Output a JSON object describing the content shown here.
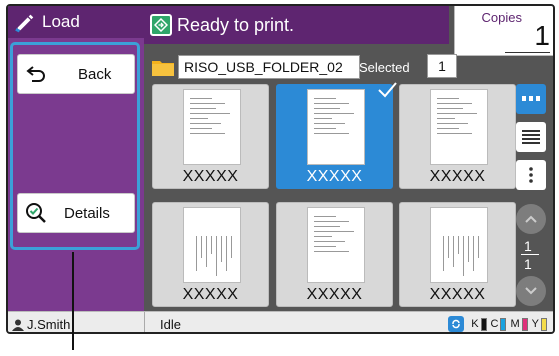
{
  "left_panel": {
    "title": "Load",
    "back_label": "Back",
    "details_label": "Details"
  },
  "status": {
    "message": "Ready to print."
  },
  "copies": {
    "label": "Copies",
    "value": "1"
  },
  "folder": {
    "name": "RISO_USB_FOLDER_02",
    "selected_label": "Selected",
    "selected_count": "1"
  },
  "files": [
    {
      "name": "XXXXX",
      "selected": false,
      "orientation": "portrait"
    },
    {
      "name": "XXXXX",
      "selected": true,
      "orientation": "portrait"
    },
    {
      "name": "XXXXX",
      "selected": false,
      "orientation": "portrait"
    },
    {
      "name": "XXXXX",
      "selected": false,
      "orientation": "landscape"
    },
    {
      "name": "XXXXX",
      "selected": false,
      "orientation": "portrait"
    },
    {
      "name": "XXXXX",
      "selected": false,
      "orientation": "landscape"
    }
  ],
  "pagination": {
    "current": "1",
    "total": "1"
  },
  "bottom_bar": {
    "user": "J.Smith",
    "status": "Idle",
    "inks": [
      {
        "label": "K",
        "color": "#111111"
      },
      {
        "label": "C",
        "color": "#1aa3e0"
      },
      {
        "label": "M",
        "color": "#e0307a"
      },
      {
        "label": "Y",
        "color": "#f4dc4a"
      }
    ]
  },
  "colors": {
    "accent_purple": "#7b3a8f",
    "header_purple": "#5e2570",
    "selection_blue": "#2c8ad6",
    "highlight_blue": "#3ca0d8",
    "ready_green": "#2fa66a"
  }
}
